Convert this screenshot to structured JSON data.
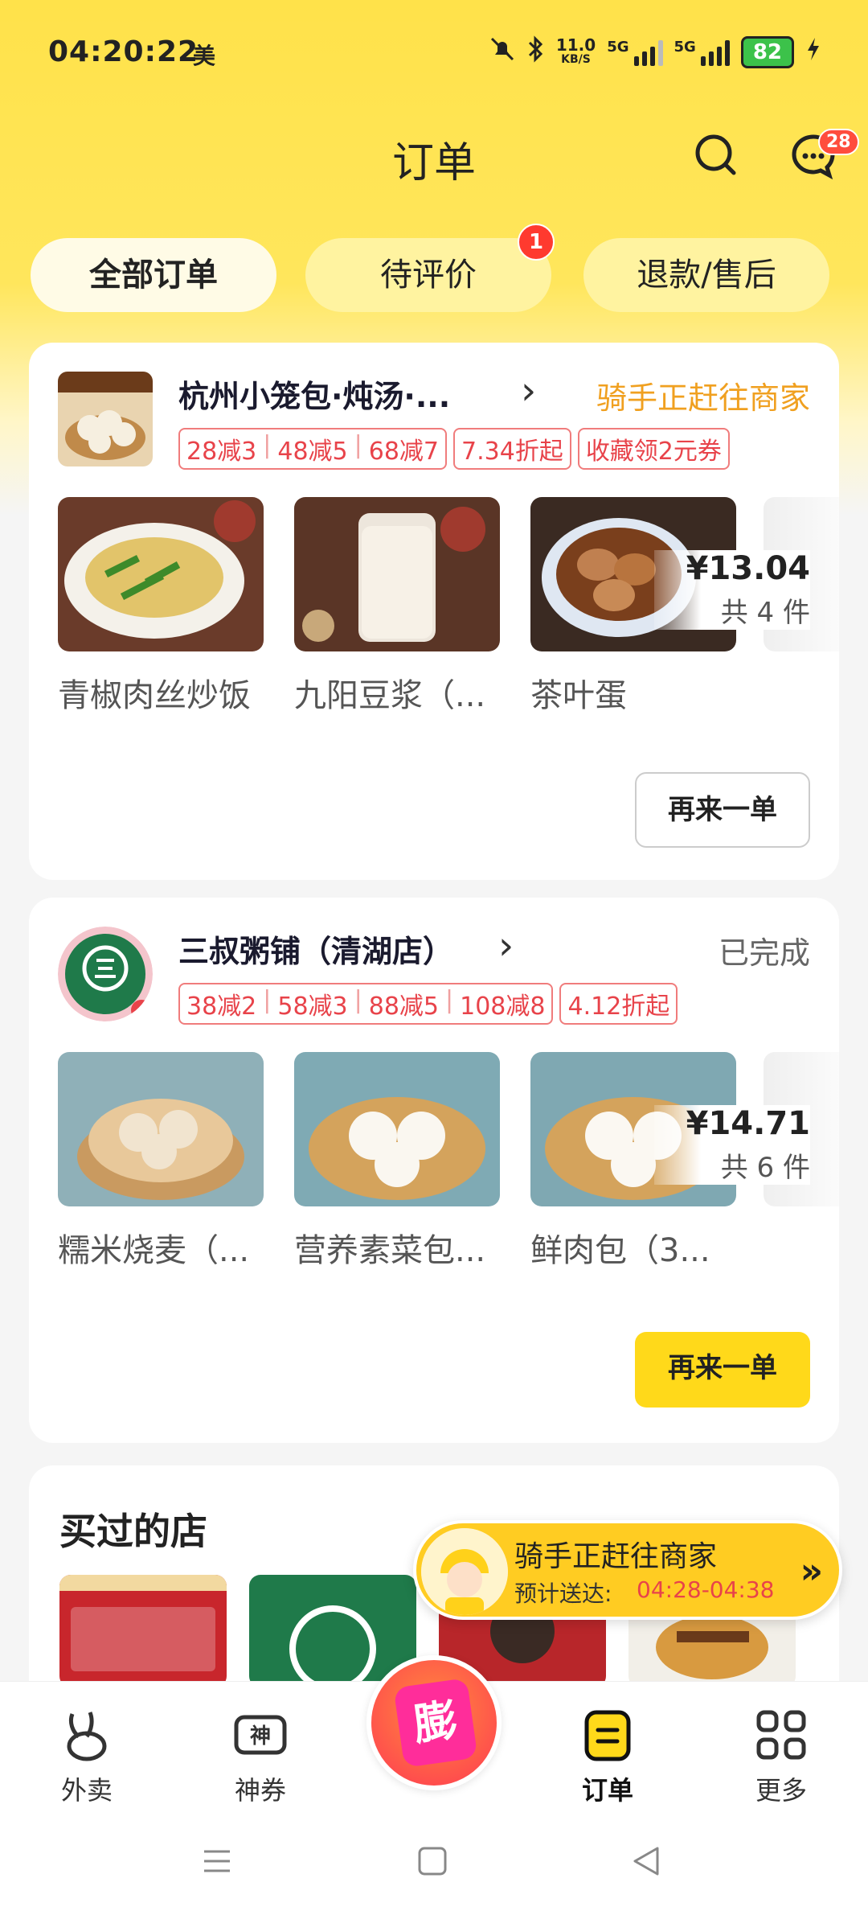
{
  "status_bar": {
    "time": "04:20:22",
    "app_icon_label": "美",
    "net_speed": "11.0",
    "net_unit": "KB/S",
    "signal1_label": "5G",
    "signal2_label": "5G",
    "battery": "82",
    "icons": [
      "mute-icon",
      "bluetooth-icon",
      "signal-icon",
      "battery-icon",
      "charging-icon"
    ]
  },
  "header": {
    "title": "订单",
    "message_badge": "28"
  },
  "tabs": [
    {
      "label": "全部订单",
      "active": true
    },
    {
      "label": "待评价",
      "badge": "1"
    },
    {
      "label": "退款/售后"
    }
  ],
  "orders": [
    {
      "store_name": "杭州小笼包·炖汤·...",
      "status": "骑手正赶往商家",
      "status_color": "#f0a020",
      "promo_group1": [
        "28减3",
        "48减5",
        "68减7"
      ],
      "promo_single": [
        "7.34折起",
        "收藏领2元券"
      ],
      "items": [
        "青椒肉丝炒饭",
        "九阳豆浆（...",
        "茶叶蛋"
      ],
      "price": "¥13.04",
      "count": "共 4 件",
      "reorder_label": "再来一单"
    },
    {
      "store_name": "三叔粥铺（清湖店）",
      "status": "已完成",
      "status_color": "#666666",
      "promo_group1": [
        "38减2",
        "58减3",
        "88减5",
        "108减8"
      ],
      "promo_single": [
        "4.12折起"
      ],
      "items": [
        "糯米烧麦（...",
        "营养素菜包...",
        "鲜肉包（3..."
      ],
      "price": "¥14.71",
      "count": "共 6 件",
      "reorder_label": "再来一单"
    }
  ],
  "bought": {
    "title": "买过的店"
  },
  "rider_float": {
    "title": "骑手正赶往商家",
    "eta_label": "预计送达:",
    "eta_time": "04:28-04:38"
  },
  "bottom_nav": [
    {
      "label": "外卖"
    },
    {
      "label": "神券"
    },
    {
      "label": "订单",
      "active": true
    },
    {
      "label": "更多"
    }
  ],
  "fab_label": "膨",
  "colors": {
    "brand_yellow": "#ffd91a",
    "promo_red": "#e8434a",
    "status_orange": "#f0a020"
  }
}
